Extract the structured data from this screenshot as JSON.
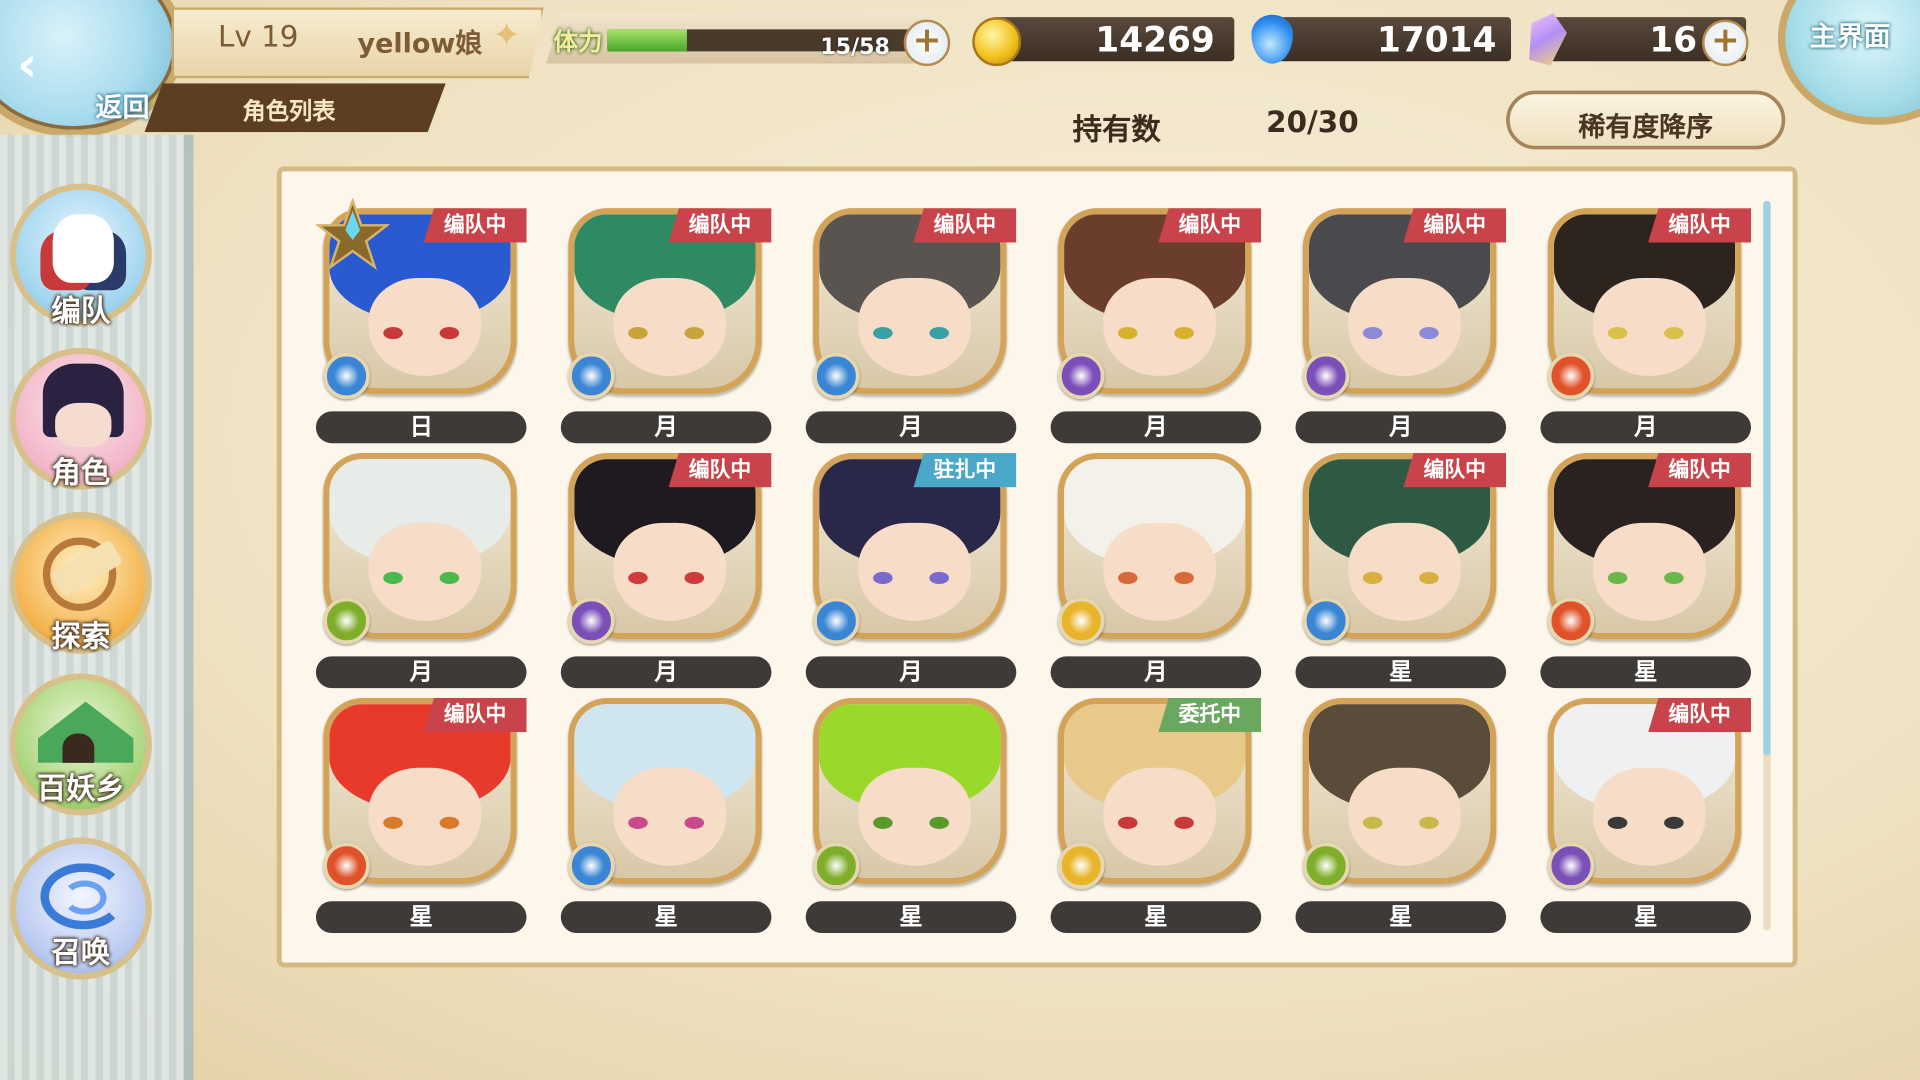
{
  "header": {
    "back_label": "返回",
    "level": "Lv 19",
    "player_name": "yellow娘",
    "tab_label": "角色列表",
    "stamina_label": "体力",
    "stamina_current": 15,
    "stamina_max": 58,
    "stamina_text": "15/58",
    "gold": "14269",
    "gems": "17014",
    "crystals": "16",
    "home_label": "主界面"
  },
  "inventory": {
    "owned_label": "持有数",
    "owned_value": "20/30",
    "sort_label": "稀有度降序"
  },
  "sidebar": {
    "items": [
      {
        "label": "编队",
        "icon": "team-icon"
      },
      {
        "label": "角色",
        "icon": "character-icon"
      },
      {
        "label": "探索",
        "icon": "explore-icon"
      },
      {
        "label": "百妖乡",
        "icon": "village-icon"
      },
      {
        "label": "召唤",
        "icon": "summon-icon"
      }
    ]
  },
  "scroll": {
    "visible_fraction": 0.76
  },
  "colors": {
    "tag_team": "#c8444a",
    "tag_station": "#4aa7c8",
    "tag_commission": "#6aa860",
    "element_water": "#3a86d4",
    "element_dark": "#7a4fb8",
    "element_fire": "#e0532a",
    "element_wind": "#7fae2a",
    "element_light": "#e8b42a"
  },
  "characters": [
    {
      "rank": "日",
      "tag": "编队中",
      "element": "water-element-icon",
      "hair": "#2a5ad0",
      "eyes": "#c83a3a",
      "star": true
    },
    {
      "rank": "月",
      "tag": "编队中",
      "element": "water-element-icon",
      "hair": "#2f8a64",
      "eyes": "#c8a23a"
    },
    {
      "rank": "月",
      "tag": "编队中",
      "element": "water-element-icon",
      "hair": "#5a5450",
      "eyes": "#3aa0a8"
    },
    {
      "rank": "月",
      "tag": "编队中",
      "element": "dark-element-icon",
      "hair": "#6a3e2a",
      "eyes": "#d8b030"
    },
    {
      "rank": "月",
      "tag": "编队中",
      "element": "dark-element-icon",
      "hair": "#4a4a4e",
      "eyes": "#8a8ad8"
    },
    {
      "rank": "月",
      "tag": "编队中",
      "element": "fire-element-icon",
      "hair": "#2e241e",
      "eyes": "#d8c04a"
    },
    {
      "rank": "月",
      "tag": "",
      "element": "wind-element-icon",
      "hair": "#e8ece8",
      "eyes": "#4ab84a"
    },
    {
      "rank": "月",
      "tag": "编队中",
      "element": "dark-element-icon",
      "hair": "#1e1a20",
      "eyes": "#d03a3a"
    },
    {
      "rank": "月",
      "tag": "驻扎中",
      "element": "water-element-icon",
      "hair": "#2a2848",
      "eyes": "#7a6ad0"
    },
    {
      "rank": "月",
      "tag": "",
      "element": "light-element-icon",
      "hair": "#f4f0ea",
      "eyes": "#d86a3a"
    },
    {
      "rank": "星",
      "tag": "编队中",
      "element": "water-element-icon",
      "hair": "#2e5a44",
      "eyes": "#d8b040"
    },
    {
      "rank": "星",
      "tag": "编队中",
      "element": "fire-element-icon",
      "hair": "#2a2220",
      "eyes": "#6ab84a"
    },
    {
      "rank": "星",
      "tag": "编队中",
      "element": "fire-element-icon",
      "hair": "#e83a2a",
      "eyes": "#d87a2a"
    },
    {
      "rank": "星",
      "tag": "",
      "element": "water-element-icon",
      "hair": "#cfe6f0",
      "eyes": "#c84a8a"
    },
    {
      "rank": "星",
      "tag": "",
      "element": "wind-element-icon",
      "hair": "#9ad82a",
      "eyes": "#5a9a2a"
    },
    {
      "rank": "星",
      "tag": "委托中",
      "element": "light-element-icon",
      "hair": "#e8c98a",
      "eyes": "#c83a3a"
    },
    {
      "rank": "星",
      "tag": "",
      "element": "wind-element-icon",
      "hair": "#5a4c3a",
      "eyes": "#c8b84a"
    },
    {
      "rank": "星",
      "tag": "编队中",
      "element": "dark-element-icon",
      "hair": "#eef0f2",
      "eyes": "#3a3a3a"
    }
  ]
}
